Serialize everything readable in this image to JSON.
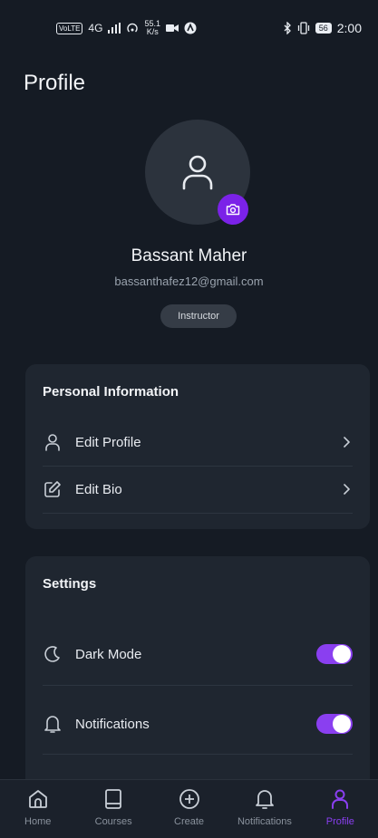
{
  "status_bar": {
    "volte": "VoLTE",
    "network": "4G",
    "speed_value": "55.1",
    "speed_unit": "K/s",
    "battery": "56",
    "time": "2:00"
  },
  "header": {
    "title": "Profile"
  },
  "profile": {
    "name": "Bassant Maher",
    "email": "bassanthafez12@gmail.com",
    "role": "Instructor"
  },
  "personal_info": {
    "title": "Personal Information",
    "items": [
      {
        "label": "Edit Profile",
        "icon": "user-icon"
      },
      {
        "label": "Edit Bio",
        "icon": "edit-icon"
      }
    ]
  },
  "settings": {
    "title": "Settings",
    "items": [
      {
        "label": "Dark Mode",
        "icon": "moon-icon",
        "enabled": true
      },
      {
        "label": "Notifications",
        "icon": "bell-icon",
        "enabled": true
      }
    ]
  },
  "bottom_nav": {
    "items": [
      {
        "label": "Home",
        "icon": "home-icon",
        "active": false
      },
      {
        "label": "Courses",
        "icon": "book-icon",
        "active": false
      },
      {
        "label": "Create",
        "icon": "plus-circle-icon",
        "active": false
      },
      {
        "label": "Notifications",
        "icon": "bell-icon",
        "active": false
      },
      {
        "label": "Profile",
        "icon": "user-icon",
        "active": true
      }
    ]
  },
  "colors": {
    "background": "#151b24",
    "card": "#1f2630",
    "accent": "#8a3ff0",
    "camera_button": "#7b22e8",
    "muted_text": "#9aa3ae"
  }
}
